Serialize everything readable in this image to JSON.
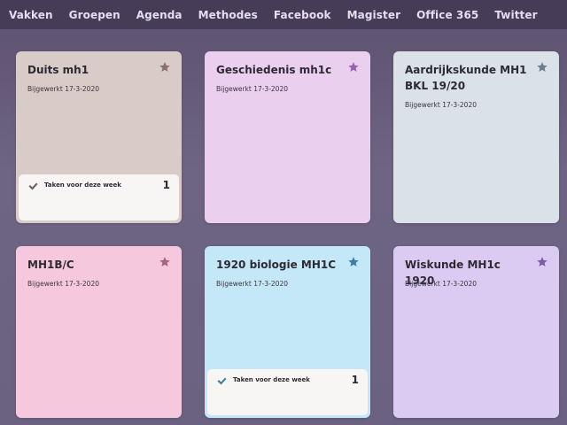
{
  "nav": [
    "Vakken",
    "Groepen",
    "Agenda",
    "Methodes",
    "Facebook",
    "Magister",
    "Office 365",
    "Twitter"
  ],
  "cards": [
    {
      "title": "Duits mh1",
      "updated": "Bijgewerkt 17-3-2020",
      "bg": "#d9ccc8",
      "star": "#8a6e70",
      "tasks_label": "Taken voor deze week",
      "tasks_count": "1",
      "check": "#6f5e58"
    },
    {
      "title": "Geschiedenis mh1c",
      "updated": "Bijgewerkt 17-3-2020",
      "bg": "#ebcfee",
      "star": "#9a63b0"
    },
    {
      "title": "Aardrijkskunde MH1 BKL 19/20",
      "updated": "Bijgewerkt 17-3-2020",
      "bg": "#dae1e7",
      "star": "#6b7c8a"
    },
    {
      "title": "MH1B/C",
      "updated": "Bijgewerkt 17-3-2020",
      "bg": "#f6c8dd",
      "star": "#a36585"
    },
    {
      "title": "1920 biologie MH1C",
      "updated": "Bijgewerkt 17-3-2020",
      "bg": "#c5e8f9",
      "star": "#3b7fa6",
      "tasks_label": "Taken voor deze week",
      "tasks_count": "1",
      "check": "#3b7fa6"
    },
    {
      "title": "Wiskunde MH1c 1920",
      "updated": "Bijgewerkt 17-3-2020",
      "bg": "#dbcbf2",
      "star": "#7b5ea5"
    }
  ],
  "icons": {
    "star": "star-icon",
    "check": "checkmark-icon"
  }
}
